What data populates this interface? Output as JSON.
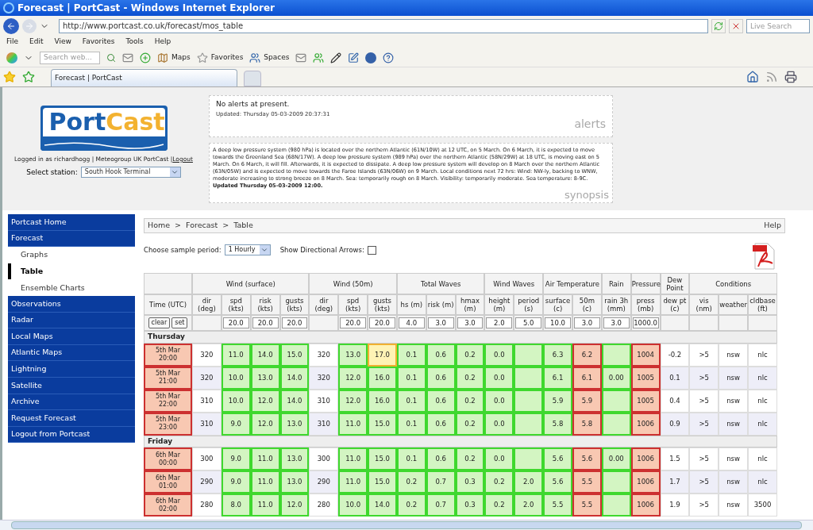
{
  "window": {
    "title": "Forecast | PortCast - Windows Internet Explorer"
  },
  "address_bar": {
    "url": "http://www.portcast.co.uk/forecast/mos_table",
    "search_placeholder": "Live Search"
  },
  "menu": [
    "File",
    "Edit",
    "View",
    "Favorites",
    "Tools",
    "Help"
  ],
  "toolbar": {
    "search_placeholder": "Search web...",
    "buttons": [
      "Maps",
      "Favorites",
      "Spaces"
    ]
  },
  "tab": {
    "title": "Forecast | PortCast"
  },
  "logo": {
    "first": "Port",
    "second": "Cast"
  },
  "login": {
    "text": "Logged in as richardhogg | Meteogroup UK PortCast | ",
    "link": "Logout"
  },
  "station": {
    "label": "Select station:",
    "value": "South Hook Terminal"
  },
  "alerts": {
    "message": "No alerts at present.",
    "updated": "Updated: Thursday 05-03-2009 20:37:31",
    "caption": "alerts"
  },
  "synopsis": {
    "text": "A deep low pressure system (980 hPa) is located over the northern Atlantic (61N/10W) at 12 UTC, on 5 March. On 6 March, it is expected to move towards the Greenland Sea (68N/17W). A deep low pressure system (989 hPa) over the northern Atlantic (58N/29W) at 18 UTC, is moving east on 5 March. On 6 March, it will fill. Afterwards, it is expected to dissipate. A deep low pressure system will develop on 8 March over the northern Atlantic (63N/05W) and is expected to move towards the Faroe Islands (63N/06W) on 9 March. Local conditions next 72 hrs: Wind: NW-ly, backing to WNW, moderate increasing to strong breeze on 8 March. Sea: temporarily rough on 8 March. Visibility: temporarily moderate. Sea temperature: 8-9C. **Updated Thursday 05-03-2009 12:00.**",
    "caption": "synopsis"
  },
  "sidebar": {
    "items": [
      {
        "label": "Portcast Home",
        "selected": false
      },
      {
        "label": "Forecast",
        "selected": false,
        "children": [
          {
            "label": "Graphs",
            "selected": false
          },
          {
            "label": "Table",
            "selected": true
          },
          {
            "label": "Ensemble Charts",
            "selected": false
          }
        ]
      },
      {
        "label": "Observations",
        "selected": false
      },
      {
        "label": "Radar",
        "selected": false
      },
      {
        "label": "Local Maps",
        "selected": false
      },
      {
        "label": "Atlantic Maps",
        "selected": false
      },
      {
        "label": "Lightning",
        "selected": false
      },
      {
        "label": "Satellite",
        "selected": false
      },
      {
        "label": "Archive",
        "selected": false
      },
      {
        "label": "Request Forecast",
        "selected": false
      },
      {
        "label": "Logout from Portcast",
        "selected": false
      }
    ]
  },
  "breadcrumb": {
    "items": [
      "Home",
      "Forecast",
      "Table"
    ],
    "separator": ">",
    "help": "Help"
  },
  "controls": {
    "period_label": "Choose sample period:",
    "period_value": "1 Hourly",
    "arrows_label": "Show Directional Arrows:",
    "arrows_checked": false
  },
  "table": {
    "time_column": {
      "label": "Time (UTC)",
      "buttons": [
        "clear",
        "set"
      ]
    },
    "groups": [
      {
        "label": "Wind (surface)",
        "columns": [
          {
            "label": "dir",
            "unit": "(deg)"
          },
          {
            "label": "spd",
            "unit": "(kts)",
            "threshold": "20.0"
          },
          {
            "label": "risk",
            "unit": "(kts)",
            "threshold": "20.0"
          },
          {
            "label": "gusts",
            "unit": "(kts)",
            "threshold": "20.0"
          }
        ]
      },
      {
        "label": "Wind (50m)",
        "columns": [
          {
            "label": "dir",
            "unit": "(deg)"
          },
          {
            "label": "spd",
            "unit": "(kts)",
            "threshold": "20.0"
          },
          {
            "label": "gusts",
            "unit": "(kts)",
            "threshold": "20.0"
          }
        ]
      },
      {
        "label": "Total Waves",
        "columns": [
          {
            "label": "hs (m)",
            "threshold": "4.0"
          },
          {
            "label": "risk (m)",
            "threshold": "3.0"
          },
          {
            "label": "hmax",
            "unit": "(m)",
            "threshold": "3.0"
          }
        ]
      },
      {
        "label": "Wind Waves",
        "columns": [
          {
            "label": "height",
            "unit": "(m)",
            "threshold": "2.0"
          },
          {
            "label": "period",
            "unit": "(s)",
            "threshold": "5.0"
          }
        ]
      },
      {
        "label": "Air Temperature",
        "columns": [
          {
            "label": "surface",
            "unit": "(c)",
            "threshold": "10.0"
          },
          {
            "label": "50m",
            "unit": "(c)",
            "threshold": "3.0"
          }
        ]
      },
      {
        "label": "Rain",
        "columns": [
          {
            "label": "rain 3h",
            "unit": "(mm)",
            "threshold": "3.0"
          }
        ]
      },
      {
        "label": "Pressure",
        "columns": [
          {
            "label": "press",
            "unit": "(mb)",
            "threshold": "1000.0"
          }
        ]
      },
      {
        "label": "Dew Point",
        "columns": [
          {
            "label": "dew pt",
            "unit": "(c)"
          }
        ]
      },
      {
        "label": "Conditions",
        "columns": [
          {
            "label": "vis",
            "unit": "(nm)"
          },
          {
            "label": "weather"
          },
          {
            "label": "cldbase",
            "unit": "(ft)"
          }
        ]
      }
    ],
    "days": [
      {
        "label": "Thursday",
        "rows": [
          {
            "date": "5th Mar",
            "hour": "20:00",
            "color": "#f8c8b2",
            "cells": [
              {
                "text": "320"
              },
              {
                "text": "11.0",
                "color": "#d3f5c2"
              },
              {
                "text": "14.0",
                "color": "#d3f5c2"
              },
              {
                "text": "15.0",
                "color": "#d3f5c2"
              },
              {
                "text": "320"
              },
              {
                "text": "13.0",
                "color": "#d3f5c2"
              },
              {
                "text": "17.0",
                "color": "#fff3b5"
              },
              {
                "text": "0.1",
                "color": "#d3f5c2"
              },
              {
                "text": "0.6",
                "color": "#d3f5c2"
              },
              {
                "text": "0.2",
                "color": "#d3f5c2"
              },
              {
                "text": "0.0",
                "color": "#d3f5c2"
              },
              {
                "color": "#d3f5c2"
              },
              {
                "text": "6.3",
                "color": "#d3f5c2"
              },
              {
                "text": "6.2",
                "color": "#f8c8b2"
              },
              {
                "color": "#d3f5c2"
              },
              {
                "text": "1004",
                "color": "#f8c8b2"
              },
              {
                "text": "-0.2"
              },
              {
                "text": ">5"
              },
              {
                "text": "nsw"
              },
              {
                "text": "nlc"
              }
            ]
          },
          {
            "date": "5th Mar",
            "hour": "21:00",
            "color": "#f8c8b2",
            "cells": [
              {
                "text": "320"
              },
              {
                "text": "10.0",
                "color": "#d3f5c2"
              },
              {
                "text": "13.0",
                "color": "#d3f5c2"
              },
              {
                "text": "14.0",
                "color": "#d3f5c2"
              },
              {
                "text": "320"
              },
              {
                "text": "12.0",
                "color": "#d3f5c2"
              },
              {
                "text": "16.0",
                "color": "#d3f5c2"
              },
              {
                "text": "0.1",
                "color": "#d3f5c2"
              },
              {
                "text": "0.6",
                "color": "#d3f5c2"
              },
              {
                "text": "0.2",
                "color": "#d3f5c2"
              },
              {
                "text": "0.0",
                "color": "#d3f5c2"
              },
              {
                "color": "#d3f5c2"
              },
              {
                "text": "6.1",
                "color": "#d3f5c2"
              },
              {
                "text": "6.1",
                "color": "#f8c8b2"
              },
              {
                "text": "0.00",
                "color": "#d3f5c2"
              },
              {
                "text": "1005",
                "color": "#f8c8b2"
              },
              {
                "text": "0.1"
              },
              {
                "text": ">5"
              },
              {
                "text": "nsw"
              },
              {
                "text": "nlc"
              }
            ]
          },
          {
            "date": "5th Mar",
            "hour": "22:00",
            "color": "#f8c8b2",
            "cells": [
              {
                "text": "310"
              },
              {
                "text": "10.0",
                "color": "#d3f5c2"
              },
              {
                "text": "12.0",
                "color": "#d3f5c2"
              },
              {
                "text": "14.0",
                "color": "#d3f5c2"
              },
              {
                "text": "310"
              },
              {
                "text": "12.0",
                "color": "#d3f5c2"
              },
              {
                "text": "16.0",
                "color": "#d3f5c2"
              },
              {
                "text": "0.1",
                "color": "#d3f5c2"
              },
              {
                "text": "0.6",
                "color": "#d3f5c2"
              },
              {
                "text": "0.2",
                "color": "#d3f5c2"
              },
              {
                "text": "0.0",
                "color": "#d3f5c2"
              },
              {
                "color": "#d3f5c2"
              },
              {
                "text": "5.9",
                "color": "#d3f5c2"
              },
              {
                "text": "5.9",
                "color": "#f8c8b2"
              },
              {
                "color": "#d3f5c2"
              },
              {
                "text": "1005",
                "color": "#f8c8b2"
              },
              {
                "text": "0.4"
              },
              {
                "text": ">5"
              },
              {
                "text": "nsw"
              },
              {
                "text": "nlc"
              }
            ]
          },
          {
            "date": "5th Mar",
            "hour": "23:00",
            "color": "#f8c8b2",
            "cells": [
              {
                "text": "310"
              },
              {
                "text": "9.0",
                "color": "#d3f5c2"
              },
              {
                "text": "12.0",
                "color": "#d3f5c2"
              },
              {
                "text": "13.0",
                "color": "#d3f5c2"
              },
              {
                "text": "310"
              },
              {
                "text": "11.0",
                "color": "#d3f5c2"
              },
              {
                "text": "15.0",
                "color": "#d3f5c2"
              },
              {
                "text": "0.1",
                "color": "#d3f5c2"
              },
              {
                "text": "0.6",
                "color": "#d3f5c2"
              },
              {
                "text": "0.2",
                "color": "#d3f5c2"
              },
              {
                "text": "0.0",
                "color": "#d3f5c2"
              },
              {
                "color": "#d3f5c2"
              },
              {
                "text": "5.8",
                "color": "#d3f5c2"
              },
              {
                "text": "5.8",
                "color": "#f8c8b2"
              },
              {
                "color": "#d3f5c2"
              },
              {
                "text": "1006",
                "color": "#f8c8b2"
              },
              {
                "text": "0.9"
              },
              {
                "text": ">5"
              },
              {
                "text": "nsw"
              },
              {
                "text": "nlc"
              }
            ]
          }
        ]
      },
      {
        "label": "Friday",
        "rows": [
          {
            "date": "6th Mar",
            "hour": "00:00",
            "color": "#f8c8b2",
            "cells": [
              {
                "text": "300"
              },
              {
                "text": "9.0",
                "color": "#d3f5c2"
              },
              {
                "text": "11.0",
                "color": "#d3f5c2"
              },
              {
                "text": "13.0",
                "color": "#d3f5c2"
              },
              {
                "text": "300"
              },
              {
                "text": "11.0",
                "color": "#d3f5c2"
              },
              {
                "text": "15.0",
                "color": "#d3f5c2"
              },
              {
                "text": "0.1",
                "color": "#d3f5c2"
              },
              {
                "text": "0.6",
                "color": "#d3f5c2"
              },
              {
                "text": "0.2",
                "color": "#d3f5c2"
              },
              {
                "text": "0.0",
                "color": "#d3f5c2"
              },
              {
                "color": "#d3f5c2"
              },
              {
                "text": "5.6",
                "color": "#d3f5c2"
              },
              {
                "text": "5.6",
                "color": "#f8c8b2"
              },
              {
                "text": "0.00",
                "color": "#d3f5c2"
              },
              {
                "text": "1006",
                "color": "#f8c8b2"
              },
              {
                "text": "1.5"
              },
              {
                "text": ">5"
              },
              {
                "text": "nsw"
              },
              {
                "text": "nlc"
              }
            ]
          },
          {
            "date": "6th Mar",
            "hour": "01:00",
            "color": "#f8c8b2",
            "cells": [
              {
                "text": "290"
              },
              {
                "text": "9.0",
                "color": "#d3f5c2"
              },
              {
                "text": "11.0",
                "color": "#d3f5c2"
              },
              {
                "text": "13.0",
                "color": "#d3f5c2"
              },
              {
                "text": "290"
              },
              {
                "text": "11.0",
                "color": "#d3f5c2"
              },
              {
                "text": "15.0",
                "color": "#d3f5c2"
              },
              {
                "text": "0.2",
                "color": "#d3f5c2"
              },
              {
                "text": "0.7",
                "color": "#d3f5c2"
              },
              {
                "text": "0.3",
                "color": "#d3f5c2"
              },
              {
                "text": "0.2",
                "color": "#d3f5c2"
              },
              {
                "text": "2.0",
                "color": "#d3f5c2"
              },
              {
                "text": "5.6",
                "color": "#d3f5c2"
              },
              {
                "text": "5.5",
                "color": "#f8c8b2"
              },
              {
                "color": "#d3f5c2"
              },
              {
                "text": "1006",
                "color": "#f8c8b2"
              },
              {
                "text": "1.7"
              },
              {
                "text": ">5"
              },
              {
                "text": "nsw"
              },
              {
                "text": "nlc"
              }
            ]
          },
          {
            "date": "6th Mar",
            "hour": "02:00",
            "color": "#f8c8b2",
            "cells": [
              {
                "text": "280"
              },
              {
                "text": "8.0",
                "color": "#d3f5c2"
              },
              {
                "text": "11.0",
                "color": "#d3f5c2"
              },
              {
                "text": "12.0",
                "color": "#d3f5c2"
              },
              {
                "text": "280"
              },
              {
                "text": "10.0",
                "color": "#d3f5c2"
              },
              {
                "text": "14.0",
                "color": "#d3f5c2"
              },
              {
                "text": "0.2",
                "color": "#d3f5c2"
              },
              {
                "text": "0.7",
                "color": "#d3f5c2"
              },
              {
                "text": "0.3",
                "color": "#d3f5c2"
              },
              {
                "text": "0.2",
                "color": "#d3f5c2"
              },
              {
                "text": "2.0",
                "color": "#d3f5c2"
              },
              {
                "text": "5.5",
                "color": "#d3f5c2"
              },
              {
                "text": "5.5",
                "color": "#f8c8b2"
              },
              {
                "color": "#d3f5c2"
              },
              {
                "text": "1006",
                "color": "#f8c8b2"
              },
              {
                "text": "1.9"
              },
              {
                "text": ">5"
              },
              {
                "text": "nsw"
              },
              {
                "text": "3500"
              }
            ]
          }
        ]
      }
    ]
  }
}
